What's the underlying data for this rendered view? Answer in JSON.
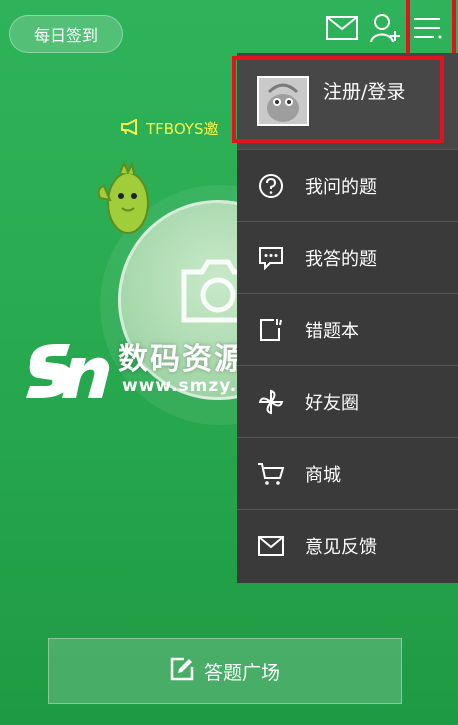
{
  "header": {
    "checkin_label": "每日签到"
  },
  "icons": {
    "mail": "mail-icon",
    "add_user": "add-user-icon",
    "menu": "menu-icon"
  },
  "announcement": {
    "text": "TFBOYS邀"
  },
  "watermark": {
    "title": "数码资源网",
    "url": "www.smzy.com"
  },
  "menu": {
    "login_label": "注册/登录",
    "items": [
      {
        "label": "我问的题",
        "icon": "question-icon"
      },
      {
        "label": "我答的题",
        "icon": "chat-icon"
      },
      {
        "label": "错题本",
        "icon": "notebook-icon"
      },
      {
        "label": "好友圈",
        "icon": "pinwheel-icon"
      },
      {
        "label": "商城",
        "icon": "cart-icon"
      },
      {
        "label": "意见反馈",
        "icon": "envelope-icon"
      }
    ]
  },
  "footer": {
    "plaza_label": "答题广场"
  },
  "colors": {
    "background": "#28aa50",
    "menu_bg": "#3a3a3a",
    "highlight": "#e0141e",
    "announce": "#f6f94a"
  }
}
